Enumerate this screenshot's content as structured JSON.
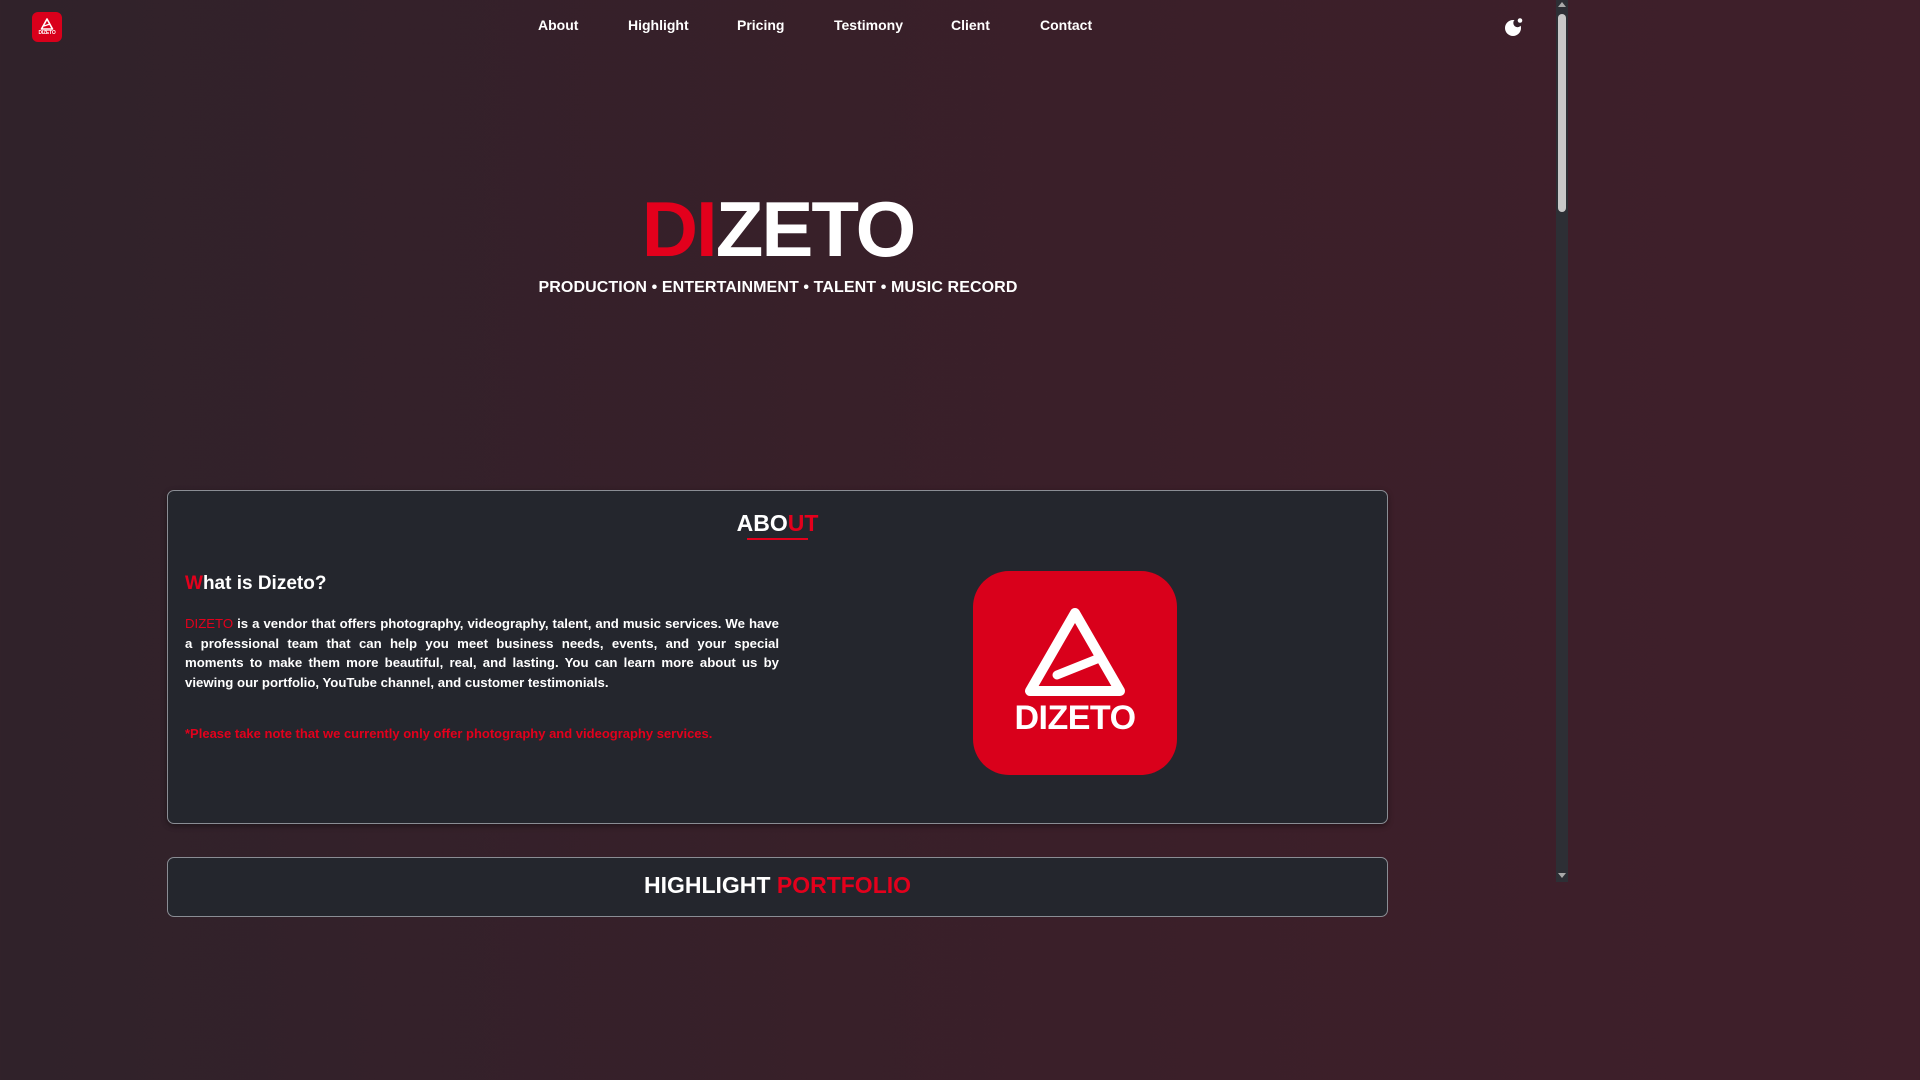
{
  "brand": {
    "mini_label": "DIZETO"
  },
  "nav": [
    "About",
    "Highlight",
    "Pricing",
    "Testimony",
    "Client",
    "Contact"
  ],
  "hero": {
    "title_accent": "DI",
    "title_rest": "ZETO",
    "subtitle": "PRODUCTION • ENTERTAINMENT • TALENT • MUSIC RECORD"
  },
  "about": {
    "title_main": "ABO",
    "title_accent": "UT",
    "question_accent": "W",
    "question_rest": "hat is Dizeto?",
    "paragraph_brand": "DIZETO",
    "paragraph": " is a vendor that offers photography, videography, talent, and music services. We have a professional team that can help you meet business needs, events, and your special moments to make them more beautiful, real, and lasting. You can learn more about us by viewing our portfolio, YouTube channel, and customer testimonials.",
    "note": "*Please take note that we currently only offer photography and videography services.",
    "logo_text": "DIZETO"
  },
  "highlight": {
    "title_main": "HIGHLIGHT ",
    "title_accent": "PORTFOLIO"
  },
  "colors": {
    "accent": "#e3001c",
    "logo_bg": "#d9001b",
    "card_bg": "#24262d"
  },
  "icons": {
    "theme_toggle": "moon-icon",
    "logo": "dizeto-logo-icon"
  }
}
